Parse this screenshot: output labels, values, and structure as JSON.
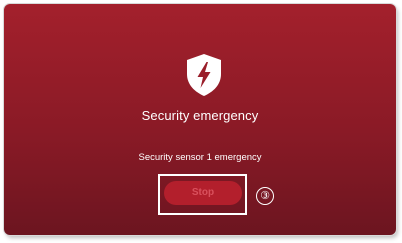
{
  "alert": {
    "icon": "shield-lightning-icon",
    "title": "Security emergency",
    "message": "Security sensor 1 emergency",
    "stop_label": "Stop"
  },
  "annotation": {
    "callout_label": "③"
  },
  "colors": {
    "background_top": "#a3202c",
    "background_bottom": "#6c1520",
    "button": "#b31f2c",
    "button_text": "#d9505c",
    "highlight": "#ffffff"
  }
}
